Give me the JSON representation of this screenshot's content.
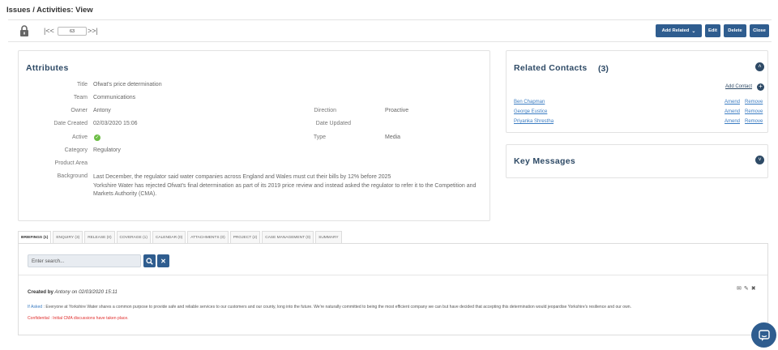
{
  "page": {
    "title": "Issues / Activities: View"
  },
  "toolbar": {
    "record_number": "63",
    "nav_first": "|<<",
    "nav_last": ">>|",
    "add_related_label": "Add Related",
    "edit_label": "Edit",
    "delete_label": "Delete",
    "close_label": "Close"
  },
  "attributes": {
    "heading": "Attributes",
    "fields": {
      "title": {
        "label": "Title",
        "value": "Ofwat's price determination"
      },
      "team": {
        "label": "Team",
        "value": "Communications"
      },
      "owner": {
        "label": "Owner",
        "value": "Antony"
      },
      "date_created": {
        "label": "Date Created",
        "value": "02/03/2020 15:06"
      },
      "active": {
        "label": "Active",
        "value": true
      },
      "category": {
        "label": "Category",
        "value": "Regulatory"
      },
      "product_area": {
        "label": "Product Area",
        "value": ""
      },
      "background": {
        "label": "Background",
        "line1": "Last December, the regulator said water companies across England and Wales must cut their bills by 12% before 2025",
        "line2": "Yorkshire Water has rejected Ofwat's final determination as part of its 2019 price review and instead asked the regulator to refer it to the Competition and Markets Authority (CMA)."
      },
      "direction": {
        "label": "Direction",
        "value": "Proactive"
      },
      "date_updated": {
        "label": "Date Updated",
        "value": ""
      },
      "type": {
        "label": "Type",
        "value": "Media"
      }
    }
  },
  "related_contacts": {
    "heading": "Related Contacts",
    "count": "(3)",
    "add_label": "Add Contact",
    "amend_label": "Amend",
    "remove_label": "Remove",
    "contacts": [
      {
        "name": "Ben Chapman"
      },
      {
        "name": "George Eustice"
      },
      {
        "name": "Priyanka Shrestha"
      }
    ]
  },
  "key_messages": {
    "heading": "Key Messages"
  },
  "tabs": [
    {
      "label": "BRIEFINGS (1)",
      "active": true
    },
    {
      "label": "ENQUIRY (3)",
      "active": false
    },
    {
      "label": "RELEASE (0)",
      "active": false
    },
    {
      "label": "COVERAGE (1)",
      "active": false
    },
    {
      "label": "CALENDAR (0)",
      "active": false
    },
    {
      "label": "ATTACHMENTS (0)",
      "active": false
    },
    {
      "label": "PROJECT (2)",
      "active": false
    },
    {
      "label": "CASE MANAGEMENT (0)",
      "active": false
    },
    {
      "label": "SUMMARY",
      "active": false
    }
  ],
  "search": {
    "placeholder": "Enter search..."
  },
  "briefing": {
    "created_label": "Created by",
    "created_detail": "Antony on 02/03/2020 15:11",
    "line1_tag": "If Asked",
    "line1_text": ": Everyone at Yorkshire Water shares a common purpose to provide safe and reliable services to our customers and our county, long into the future. We're naturally committed to being the most efficient company we can but have decided that accepting this determination would jeopardise Yorkshire's resilience and our own.",
    "line2_text": "Confidential : Initial CMA discussions have taken place."
  },
  "colors": {
    "primary": "#2f5d8f",
    "heading": "#2e4a66",
    "link": "#3b7cc2",
    "confidential": "#e0302f",
    "active_check": "#6cbe45"
  }
}
